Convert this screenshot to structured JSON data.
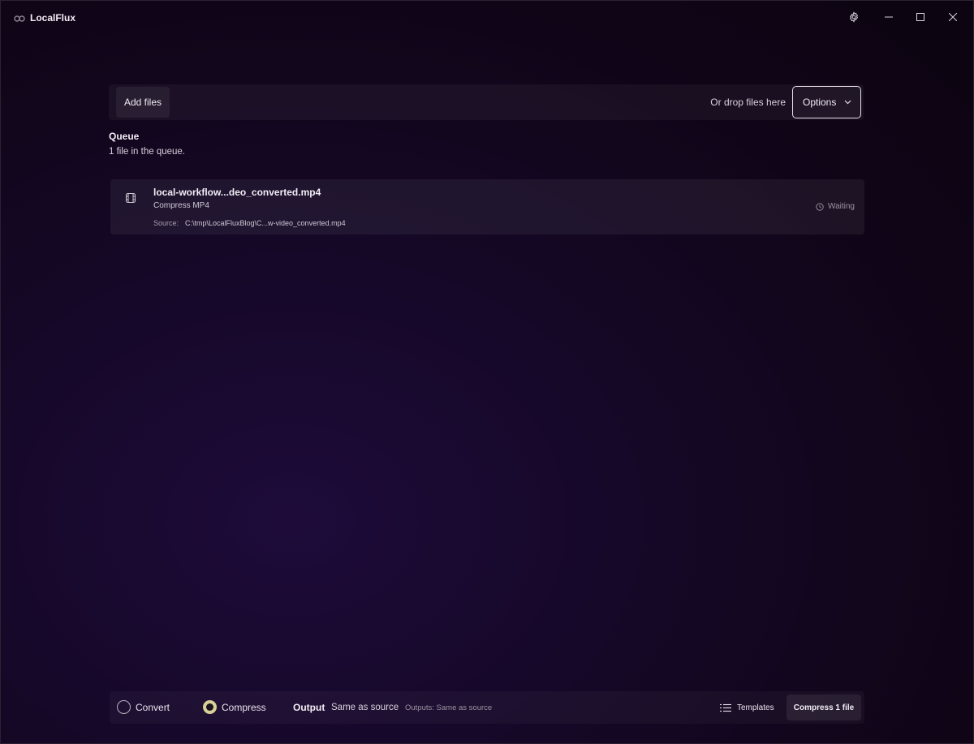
{
  "window": {
    "title": "LocalFlux",
    "icons": [
      "app-logo-icon",
      "gear-icon",
      "minimize-icon",
      "maximize-icon",
      "close-icon"
    ]
  },
  "toolbar": {
    "add_files_label": "Add files",
    "drop_hint": "Or drop files here",
    "options_label": "Options"
  },
  "queue": {
    "title": "Queue",
    "count_text": "1 file in the queue.",
    "items": [
      {
        "file_name": "local-workflow...deo_converted.mp4",
        "task": "Compress MP4",
        "source_label": "Source:",
        "source_path": "C:\\tmp\\LocalFluxBlog\\C...w-video_converted.mp4",
        "status": "Waiting"
      }
    ]
  },
  "bottom": {
    "mode_options": [
      {
        "label": "Convert",
        "selected": false
      },
      {
        "label": "Compress",
        "selected": true
      }
    ],
    "output_label": "Output",
    "output_value": "Same as source",
    "outputs_summary": "Outputs: Same as source",
    "templates_label": "Templates",
    "action_label": "Compress 1 file"
  },
  "colors": {
    "background": "#120720",
    "accent_radio": "#d9cf99",
    "options_border": "#e6e0ea"
  }
}
